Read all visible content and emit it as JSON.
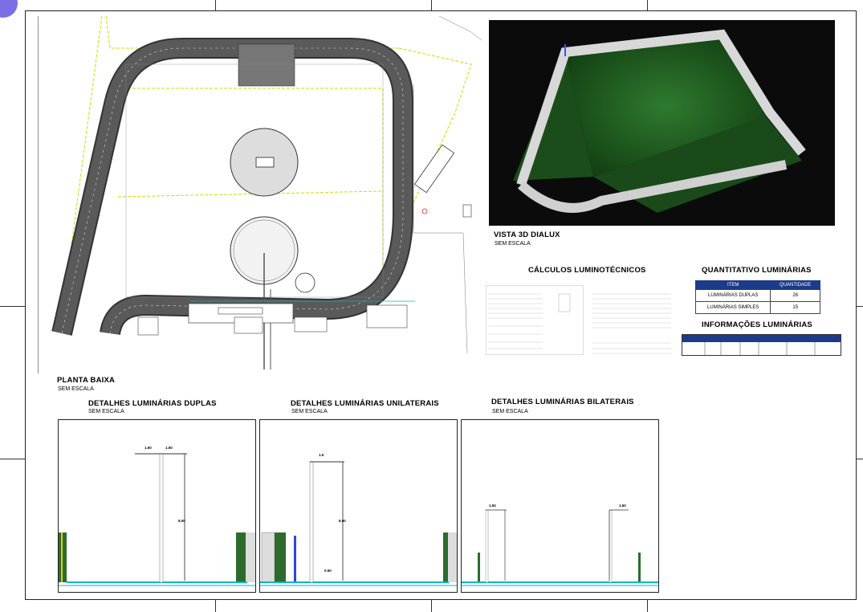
{
  "corner_color": "#7b6ee6",
  "plan": {
    "title": "PLANTA BAIXA",
    "scale": "SEM ESCALA"
  },
  "render3d": {
    "title": "VISTA 3D DIALUX",
    "scale": "SEM ESCALA"
  },
  "calculos": {
    "title": "CÁLCULOS LUMINOTÉCNICOS"
  },
  "quantitativo": {
    "title": "QUANTITATIVO LUMINÁRIAS",
    "headers": [
      "ITEM",
      "QUANTIDADE"
    ],
    "rows": [
      {
        "item": "LUMINÁRIAS DUPLAS",
        "qty": "26"
      },
      {
        "item": "LUMINÁRIAS SIMPLES",
        "qty": "15"
      }
    ]
  },
  "informacoes": {
    "title": "INFORMAÇÕES LUMINÁRIAS"
  },
  "details": [
    {
      "title": "DETALHES LUMINÁRIAS DUPLAS",
      "scale": "SEM ESCALA",
      "dims": [
        "1.50",
        "1.50",
        "8.00"
      ]
    },
    {
      "title": "DETALHES LUMINÁRIAS UNILATERAIS",
      "scale": "SEM ESCALA",
      "dims": [
        "1.5",
        "8.00",
        "0.50"
      ]
    },
    {
      "title": "DETALHES LUMINÁRIAS BILATERAIS",
      "scale": "SEM ESCALA",
      "dims": [
        "1.50",
        "1.50"
      ]
    }
  ],
  "colors": {
    "road": "#5a5a5a",
    "boundary": "#c8e000",
    "table_header": "#1e3a8a",
    "grass3d": "#1f5a1f",
    "cyan": "#00b7c7"
  }
}
